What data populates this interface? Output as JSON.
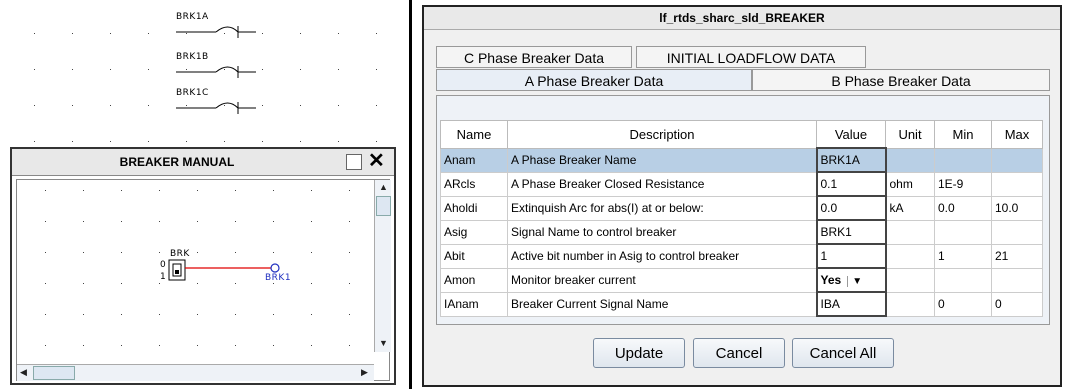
{
  "canvas": {
    "breakers": [
      "BRK1A",
      "BRK1B",
      "BRK1C"
    ]
  },
  "manual": {
    "title": "BREAKER MANUAL",
    "close_glyph": "✕",
    "switch": {
      "label": "BRK",
      "state_top": "0",
      "state_bottom": "1"
    },
    "signal_label": "BRK1"
  },
  "dialog": {
    "title": "lf_rtds_sharc_sld_BREAKER",
    "tabs_row1": [
      "C Phase Breaker Data",
      "INITIAL LOADFLOW DATA"
    ],
    "tabs_row2": [
      "A Phase Breaker Data",
      "B Phase Breaker Data"
    ],
    "selected_tab": "A Phase Breaker Data",
    "columns": [
      "Name",
      "Description",
      "Value",
      "Unit",
      "Min",
      "Max"
    ],
    "rows": [
      {
        "name": "Anam",
        "desc": "A Phase Breaker Name",
        "value": "BRK1A",
        "unit": "",
        "min": "",
        "max": ""
      },
      {
        "name": "ARcls",
        "desc": "A Phase Breaker Closed Resistance",
        "value": "0.1",
        "unit": "ohm",
        "min": "1E-9",
        "max": ""
      },
      {
        "name": "Aholdi",
        "desc": "Extinquish Arc for abs(I) at or below:",
        "value": "0.0",
        "unit": "kA",
        "min": "0.0",
        "max": "10.0"
      },
      {
        "name": "Asig",
        "desc": "Signal Name to control breaker",
        "value": "BRK1",
        "unit": "",
        "min": "",
        "max": ""
      },
      {
        "name": "Abit",
        "desc": "Active bit number in Asig to control breaker",
        "value": "1",
        "unit": "",
        "min": "1",
        "max": "21"
      },
      {
        "name": "Amon",
        "desc": "Monitor breaker current",
        "value": "Yes",
        "unit": "",
        "min": "",
        "max": ""
      },
      {
        "name": "IAnam",
        "desc": "Breaker Current Signal Name",
        "value": "IBA",
        "unit": "",
        "min": "0",
        "max": "0"
      }
    ],
    "buttons": {
      "update": "Update",
      "cancel": "Cancel",
      "cancel_all": "Cancel All"
    }
  }
}
